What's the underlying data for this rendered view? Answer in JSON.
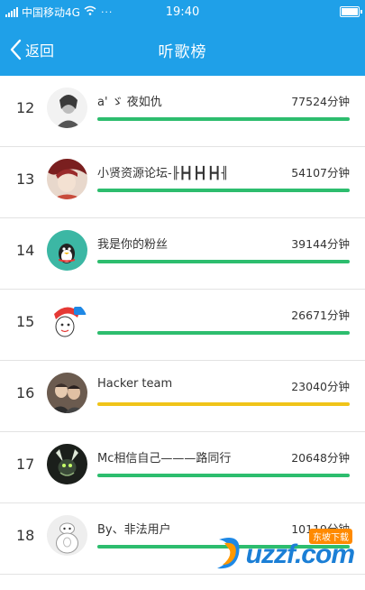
{
  "status_bar": {
    "carrier": "中国移动4G",
    "dots": "···",
    "time": "19:40"
  },
  "nav": {
    "back_label": "返回",
    "title": "听歌榜"
  },
  "colors": {
    "nav_bg": "#1fa0e8",
    "bar_green": "#2dbd6e",
    "bar_yellow": "#f0c419"
  },
  "rows": [
    {
      "rank": "12",
      "name": "a' ゞ 夜如仇",
      "minutes": "77524分钟",
      "progress": 1.0,
      "bar_color": "#2dbd6e",
      "avatar": "bw-portrait-avatar"
    },
    {
      "rank": "13",
      "name": "小贤资源论坛-╟┣┫┣┫┣┫╢",
      "minutes": "54107分钟",
      "progress": 1.0,
      "bar_color": "#2dbd6e",
      "avatar": "anime-avatar"
    },
    {
      "rank": "14",
      "name": "我是你的粉丝",
      "minutes": "39144分钟",
      "progress": 1.0,
      "bar_color": "#2dbd6e",
      "avatar": "penguin-avatar"
    },
    {
      "rank": "15",
      "name": "",
      "minutes": "26671分钟",
      "progress": 1.0,
      "bar_color": "#2dbd6e",
      "avatar": "cartoon-avatar"
    },
    {
      "rank": "16",
      "name": "Hacker team",
      "minutes": "23040分钟",
      "progress": 1.0,
      "bar_color": "#f0c419",
      "avatar": "group-avatar"
    },
    {
      "rank": "17",
      "name": "Mc相信自己———路同行",
      "minutes": "20648分钟",
      "progress": 1.0,
      "bar_color": "#2dbd6e",
      "avatar": "dark-creature-avatar"
    },
    {
      "rank": "18",
      "name": "By、非法用户",
      "minutes": "10119分钟",
      "progress": 1.0,
      "bar_color": "#2dbd6e",
      "avatar": "robot-avatar"
    }
  ],
  "watermark": {
    "brand": "uzzf.com",
    "badge": "东坡下载"
  }
}
